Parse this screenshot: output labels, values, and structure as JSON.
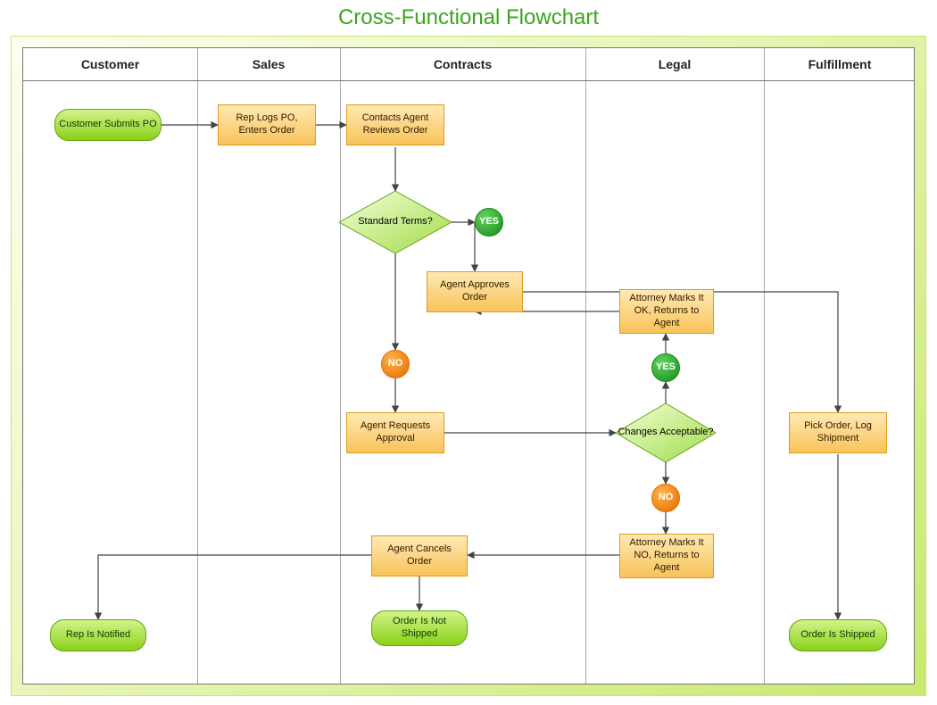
{
  "title": "Cross-Functional Flowchart",
  "lanes": [
    "Customer",
    "Sales",
    "Contracts",
    "Legal",
    "Fulfillment"
  ],
  "nodes": {
    "customer_submits": "Customer Submits PO",
    "rep_logs": "Rep Logs PO, Enters Order",
    "contacts_agent": "Contacts Agent Reviews Order",
    "standard_terms": "Standard Terms?",
    "yes1": "YES",
    "no1": "NO",
    "agent_approves": "Agent Approves Order",
    "agent_requests": "Agent Requests Approval",
    "changes_acc": "Changes Acceptable?",
    "yes2": "YES",
    "no2": "NO",
    "attorney_ok": "Attorney Marks It OK, Returns to Agent",
    "attorney_no": "Attorney Marks It NO, Returns to Agent",
    "agent_cancels": "Agent Cancels Order",
    "rep_notified": "Rep Is Notified",
    "not_shipped": "Order Is Not Shipped",
    "pick_order": "Pick Order, Log Shipment",
    "order_shipped": "Order Is Shipped"
  }
}
